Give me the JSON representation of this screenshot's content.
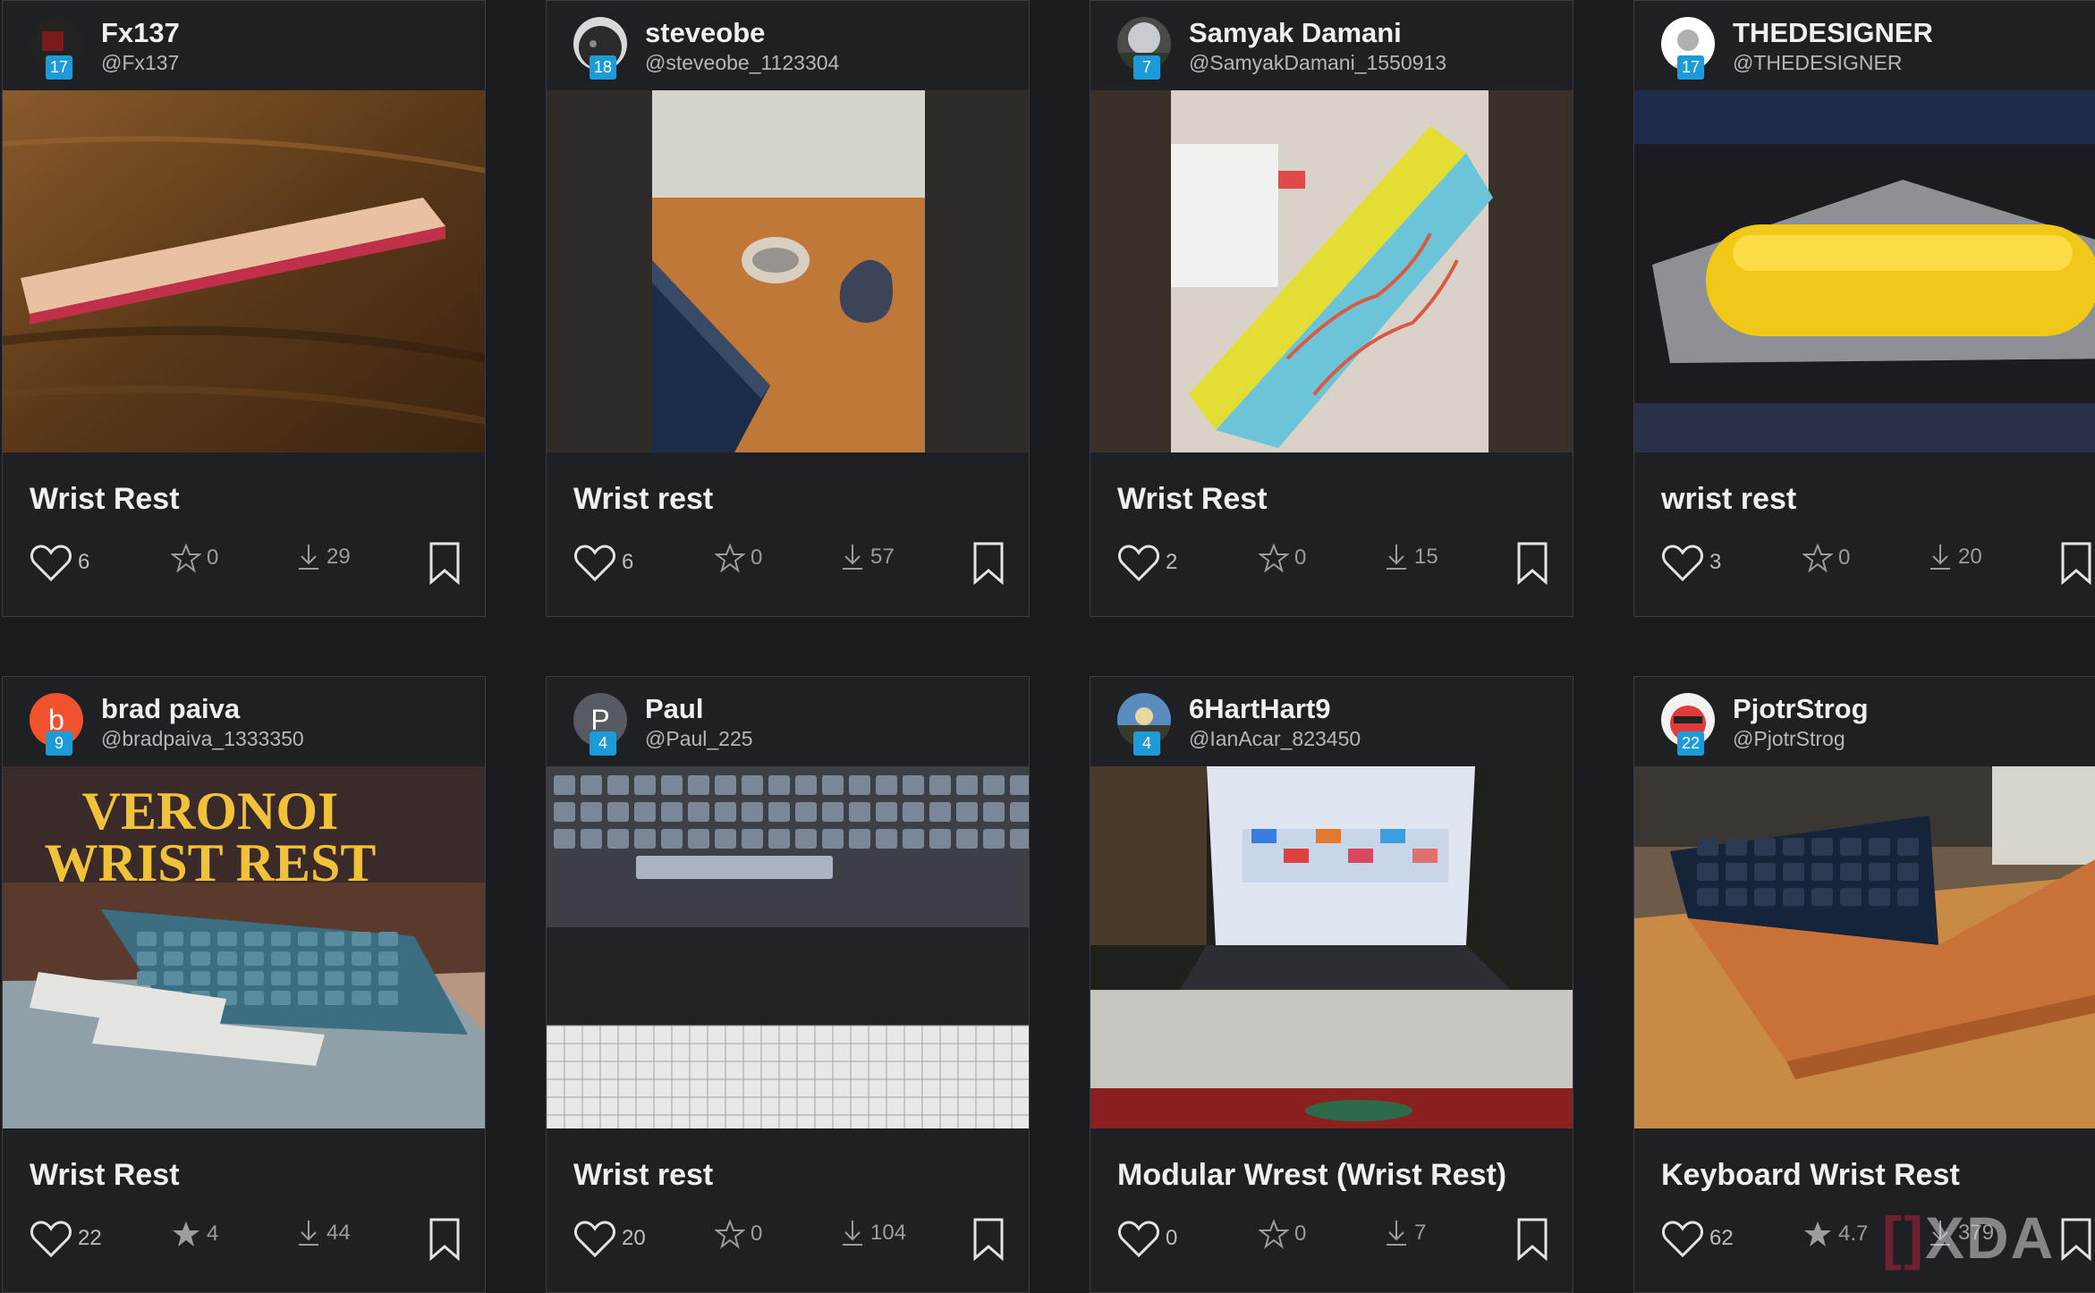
{
  "cards": [
    {
      "user": "Fx137",
      "handle": "@Fx137",
      "level": "17",
      "title": "Wrist Rest",
      "likes": "6",
      "stars": "0",
      "downloads": "29"
    },
    {
      "user": "steveobe",
      "handle": "@steveobe_1123304",
      "level": "18",
      "title": "Wrist rest",
      "likes": "6",
      "stars": "0",
      "downloads": "57"
    },
    {
      "user": "Samyak Damani",
      "handle": "@SamyakDamani_1550913",
      "level": "7",
      "title": "Wrist Rest",
      "likes": "2",
      "stars": "0",
      "downloads": "15"
    },
    {
      "user": "THEDESIGNER",
      "handle": "@THEDESIGNER",
      "level": "17",
      "title": "wrist rest",
      "likes": "3",
      "stars": "0",
      "downloads": "20"
    },
    {
      "user": "brad paiva",
      "handle": "@bradpaiva_1333350",
      "level": "9",
      "avatar_letter": "b",
      "title": "Wrist Rest",
      "likes": "22",
      "stars": "4",
      "downloads": "44"
    },
    {
      "user": "Paul",
      "handle": "@Paul_225",
      "level": "4",
      "avatar_letter": "P",
      "title": "Wrist rest",
      "likes": "20",
      "stars": "0",
      "downloads": "104"
    },
    {
      "user": "6HartHart9",
      "handle": "@IanAcar_823450",
      "level": "4",
      "title": "Modular Wrest (Wrist Rest)",
      "likes": "0",
      "stars": "0",
      "downloads": "7"
    },
    {
      "user": "PjotrStrog",
      "handle": "@PjotrStrog",
      "level": "22",
      "title": "Keyboard Wrist Rest",
      "likes": "62",
      "stars": "4.7",
      "downloads": "379"
    }
  ],
  "thumbnails": {
    "card5_overlay_line1": "VERONOI",
    "card5_overlay_line2": "WRIST REST"
  },
  "watermark": {
    "bracket": "[]",
    "text": "XDA"
  },
  "colors": {
    "background": "#1a1b1f",
    "card": "#1f2024",
    "card_border": "#3b3c42",
    "level_badge": "#1d9bd8",
    "avatar_brad": "#f0522d",
    "avatar_paul": "#555a63"
  },
  "icons": {
    "like": "heart-icon",
    "star": "star-icon",
    "download": "download-icon",
    "bookmark": "bookmark-icon"
  }
}
